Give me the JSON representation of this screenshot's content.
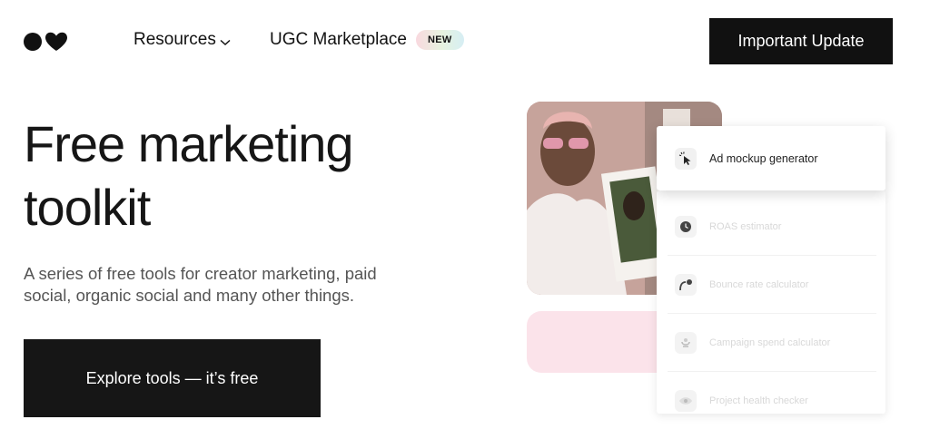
{
  "header": {
    "nav": {
      "resources": "Resources",
      "ugc": "UGC Marketplace",
      "ugc_badge": "NEW"
    },
    "cta": "Important Update"
  },
  "hero": {
    "title_line1": "Free marketing",
    "title_line2": "toolkit",
    "subtitle": "A series of free tools for creator marketing, paid social, organic social and many other things.",
    "cta": "Explore tools — it’s free"
  },
  "tools": {
    "active": {
      "label": "Ad mockup generator",
      "icon": "cursor-click-icon"
    },
    "items": [
      {
        "label": "ROAS estimator",
        "icon": "clock-icon"
      },
      {
        "label": "Bounce rate calculator",
        "icon": "bounce-icon"
      },
      {
        "label": "Campaign spend calculator",
        "icon": "money-icon"
      },
      {
        "label": "Project health checker",
        "icon": "eye-icon"
      }
    ]
  },
  "colors": {
    "brand_dark": "#111111",
    "badge_gradient": [
      "#f9d9df",
      "#e6f3df",
      "#d6eef4"
    ],
    "pink_block": "#fbe3ea"
  }
}
